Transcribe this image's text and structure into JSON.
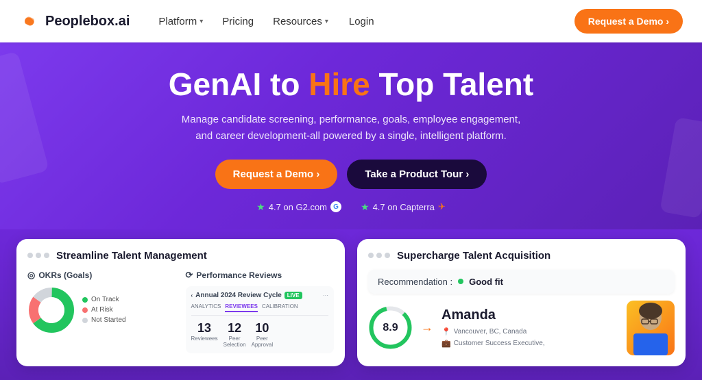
{
  "navbar": {
    "logo_text": "Peoplebox.ai",
    "nav_items": [
      {
        "label": "Platform",
        "has_dropdown": true
      },
      {
        "label": "Pricing",
        "has_dropdown": false
      },
      {
        "label": "Resources",
        "has_dropdown": true
      },
      {
        "label": "Login",
        "has_dropdown": false
      }
    ],
    "cta_label": "Request a Demo ›"
  },
  "hero": {
    "title_part1": "GenAI to ",
    "title_highlight": "Hire",
    "title_part2": " Top Talent",
    "subtitle": "Manage candidate screening, performance, goals, employee engagement, and career development-all powered by a single, intelligent platform.",
    "btn_demo": "Request a Demo ›",
    "btn_tour": "Take a Product Tour ›",
    "rating1_text": "4.7 on G2.com",
    "rating1_icon": "G",
    "rating2_text": "4.7 on Capterra",
    "rating2_icon": "✈"
  },
  "cards": {
    "left": {
      "title": "Streamline Talent Management",
      "okr": {
        "label": "OKRs (Goals)",
        "legend": [
          {
            "label": "On Track",
            "color": "#22c55e"
          },
          {
            "label": "At Risk",
            "color": "#f87171"
          },
          {
            "label": "Not Started",
            "color": "#d1d5db"
          }
        ],
        "chart": {
          "on_track": 65,
          "at_risk": 20,
          "not_started": 15
        }
      },
      "performance": {
        "label": "Performance Reviews",
        "cycle": "Annual 2024 Review Cycle",
        "badge": "LIVE",
        "tabs": [
          "ANALYTICS",
          "REVIEWEES",
          "CALIBRATION"
        ],
        "active_tab": "REVIEWEES",
        "stats": [
          {
            "num": "13",
            "label": "Reviewees"
          },
          {
            "num": "12",
            "label": "Peer\nSelection"
          },
          {
            "num": "10",
            "label": "Peer\nApproval"
          }
        ]
      }
    },
    "right": {
      "title": "Supercharge Talent Acquisition",
      "recommendation_label": "Recommendation :",
      "good_fit": "Good fit",
      "candidate_name": "Amanda",
      "candidate_location": "Vancouver, BC, Canada",
      "candidate_role": "Customer Success Executive,",
      "score": "8.9"
    }
  }
}
